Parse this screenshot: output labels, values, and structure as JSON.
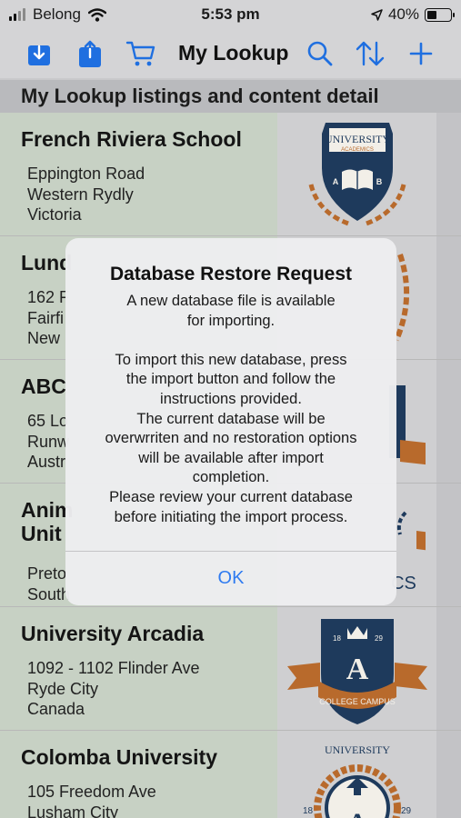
{
  "status_bar": {
    "carrier": "Belong",
    "time": "5:53 pm",
    "battery": "40%",
    "battery_level": 0.4,
    "icons": [
      "cellular-signal-icon",
      "wifi-icon",
      "location-arrow-icon",
      "battery-icon"
    ]
  },
  "toolbar": {
    "title": "My Lookup",
    "icons": [
      "download-icon",
      "share-icon",
      "cart-icon",
      "search-icon",
      "sort-icon",
      "add-icon"
    ],
    "accent_color": "#1f6fe0"
  },
  "section_header": "My Lookup listings and content detail",
  "listings": [
    {
      "title": "French Riviera School",
      "address": [
        "Eppington Road",
        "Western Rydly",
        "Victoria"
      ],
      "logo": {
        "name": "university-academics-logo",
        "text": [
          "UNIVERSITY",
          "ACADEMICS",
          "A",
          "B"
        ]
      }
    },
    {
      "title": "Lund",
      "address": [
        "162 F",
        "Fairfi",
        "New"
      ],
      "logo": {
        "name": "laurel-logo",
        "text": []
      }
    },
    {
      "title": "ABC",
      "address": [
        "65 Lo",
        "Runw",
        "Austr"
      ],
      "logo": {
        "name": "shield-ribbon-logo",
        "text": []
      }
    },
    {
      "title": "Anim Unit",
      "address": [
        "Preto",
        "South"
      ],
      "logo": {
        "name": "academics-laurel-logo",
        "text": [
          "CS"
        ]
      }
    },
    {
      "title": "University Arcadia",
      "address": [
        "1092 - 1102 Flinder Ave",
        "Ryde City",
        "Canada"
      ],
      "logo": {
        "name": "college-campus-logo",
        "text": [
          "18",
          "29",
          "A",
          "COLLEGE CAMPUS"
        ]
      }
    },
    {
      "title": "Colomba University",
      "address": [
        "105 Freedom Ave",
        "Lusham City"
      ],
      "logo": {
        "name": "university-compass-logo",
        "text": [
          "UNIVERSITY",
          "18",
          "29",
          "A"
        ]
      }
    }
  ],
  "dialog": {
    "title": "Database Restore Request",
    "message": "A new database file is available\nfor importing.\n\nTo import this new database, press\nthe import button and follow the\ninstructions provided.\nThe current database will be\noverwrriten and no restoration options\nwill be available after import\ncompletion.\nPlease review your current database\nbefore initiating the import process.",
    "button": "OK"
  }
}
